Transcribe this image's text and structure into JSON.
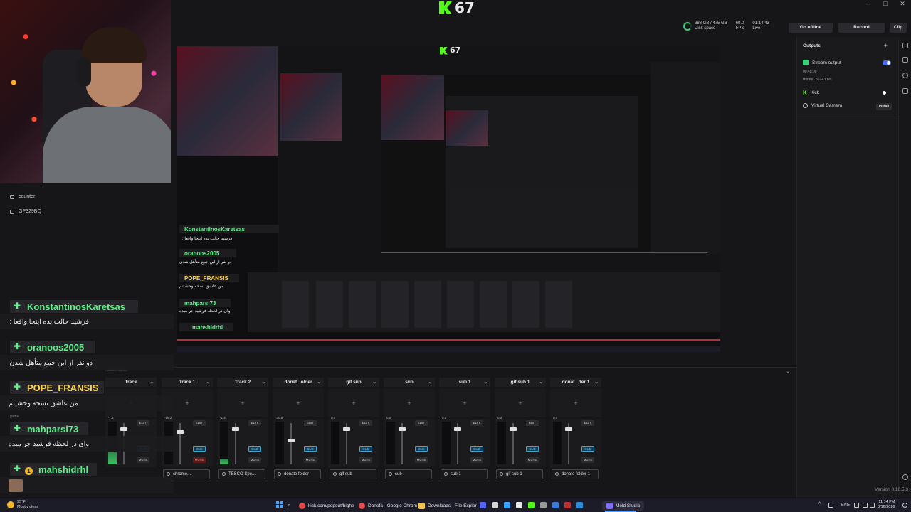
{
  "window": {
    "min": "–",
    "max": "□",
    "close": "✕"
  },
  "brand": {
    "logo_letter": "K",
    "number": "67",
    "accent": "#53fc18"
  },
  "sidebar": {
    "items": [
      {
        "label": "counter"
      },
      {
        "label": "GP329BQ"
      }
    ]
  },
  "stats": {
    "disk_value": "388 GB / 475 GB",
    "disk_label": "Disk space",
    "fps_value": "60.0",
    "fps_label": "FPS",
    "live_value": "01:14:43",
    "live_label": "Live"
  },
  "top_buttons": {
    "go_offline": "Go offline",
    "record": "Record",
    "clip": "Clip"
  },
  "outputs": {
    "title": "Outputs",
    "stream_output": "Stream output",
    "stream_time": "00:45:09",
    "bitrate_label": "Bitrate",
    "bitrate_value": "3524 Kb/s",
    "kick": "Kick",
    "virtual_camera": "Virtual Camera",
    "install": "Install"
  },
  "chat": [
    {
      "name": "KonstantinosKaretsas",
      "message": "فرشید حالت بده اینجا واقعا :",
      "badge": "diamond"
    },
    {
      "name": "oranoos2005",
      "message": "دو نفر از این جمع متأهل شدن",
      "badge": "diamond"
    },
    {
      "name": "POPE_FRANSIS",
      "message": "من عاشق نسخه وحشیتم",
      "badge": "diamond"
    },
    {
      "name": "mahparsi73",
      "message": "وای در لحظه فرشید جر میده",
      "badge": "diamond"
    },
    {
      "name": "mahshidrhl",
      "message": "",
      "badge": "diamond-coin",
      "coin": "1"
    }
  ],
  "underlay": {
    "audio_mixer": "Audio Mixer",
    "game": "game"
  },
  "mixer": {
    "strips": [
      {
        "name": "Track",
        "db": "-7.2",
        "level": 0.3,
        "fader": 0.9,
        "foot": "",
        "mute_active": false
      },
      {
        "name": "Track 1",
        "db": "-15.2",
        "level": 0.0,
        "fader": 0.82,
        "foot": "chrome...",
        "mute_active": true
      },
      {
        "name": "Track 2",
        "db": "-1.4",
        "level": 0.12,
        "fader": 0.9,
        "foot": "TESCO Spe...",
        "mute_active": false
      },
      {
        "name": "donat...older",
        "db": "-30.8",
        "level": 0.0,
        "fader": 0.62,
        "foot": "donate folder",
        "mute_active": false
      },
      {
        "name": "gif sub",
        "db": "0.0",
        "level": 0.0,
        "fader": 0.9,
        "foot": "gif sub",
        "mute_active": false
      },
      {
        "name": "sub",
        "db": "0.0",
        "level": 0.0,
        "fader": 0.9,
        "foot": "sub",
        "mute_active": false
      },
      {
        "name": "sub 1",
        "db": "0.0",
        "level": 0.0,
        "fader": 0.9,
        "foot": "sub 1",
        "mute_active": false
      },
      {
        "name": "gif sub 1",
        "db": "0.0",
        "level": 0.0,
        "fader": 0.9,
        "foot": "gif sub 1",
        "mute_active": false
      },
      {
        "name": "donat...der 1",
        "db": "0.0",
        "level": 0.0,
        "fader": 0.9,
        "foot": "donate folder 1",
        "mute_active": false
      }
    ],
    "edit_label": "EDIT",
    "cue_label": "CUE",
    "mute_label": "MUTE",
    "add": "+"
  },
  "version": "Version 0.10.5.3",
  "taskbar": {
    "weather_temp": "95°F",
    "weather_desc": "Mostly clear",
    "apps": [
      {
        "label": "kick.com/popout/bighe"
      },
      {
        "label": "Donofa - Google Chrom"
      },
      {
        "label": "Downloads - File Explor"
      },
      {
        "label": "Meld Studio"
      }
    ],
    "lang": "ENG",
    "time": "11:14 PM",
    "date": "8/16/2026"
  }
}
